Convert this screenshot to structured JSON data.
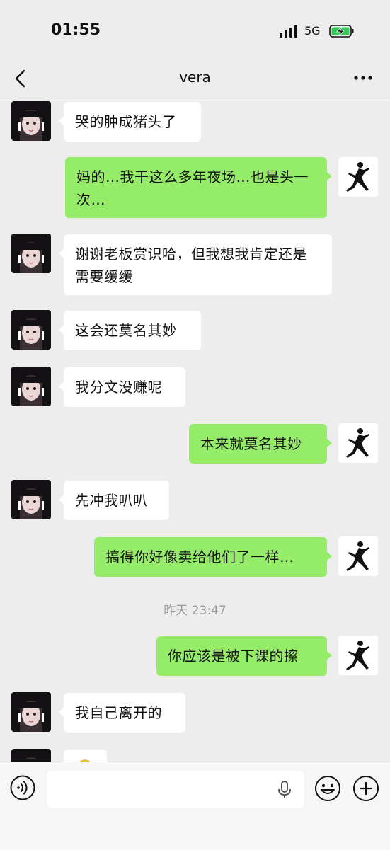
{
  "status_bar": {
    "time": "01:55",
    "network": "5G"
  },
  "header": {
    "title": "vera"
  },
  "messages": [
    {
      "side": "in",
      "text": "哭的肿成猪头了"
    },
    {
      "side": "out",
      "text": "妈的…我干这么多年夜场…也是头一次…"
    },
    {
      "side": "in",
      "text": "谢谢老板赏识哈，但我想我肯定还是需要缓缓"
    },
    {
      "side": "in",
      "text": "这会还莫名其妙"
    },
    {
      "side": "in",
      "text": "我分文没赚呢"
    },
    {
      "side": "out",
      "text": "本来就莫名其妙"
    },
    {
      "side": "in",
      "text": "先冲我叭叭"
    },
    {
      "side": "out",
      "text": "搞得你好像卖给他们了一样…"
    },
    {
      "side": "out",
      "text": "你应该是被下课的擦"
    },
    {
      "side": "in",
      "text": "我自己离开的"
    }
  ],
  "timestamp": "昨天 23:47",
  "colors": {
    "out_bubble": "#95ec69",
    "in_bubble": "#ffffff",
    "background": "#ededed"
  },
  "icons": {
    "back": "chevron-left-icon",
    "more": "more-icon",
    "voice": "voice-icon",
    "mic": "mic-icon",
    "emoji": "emoji-icon",
    "plus": "plus-icon"
  }
}
